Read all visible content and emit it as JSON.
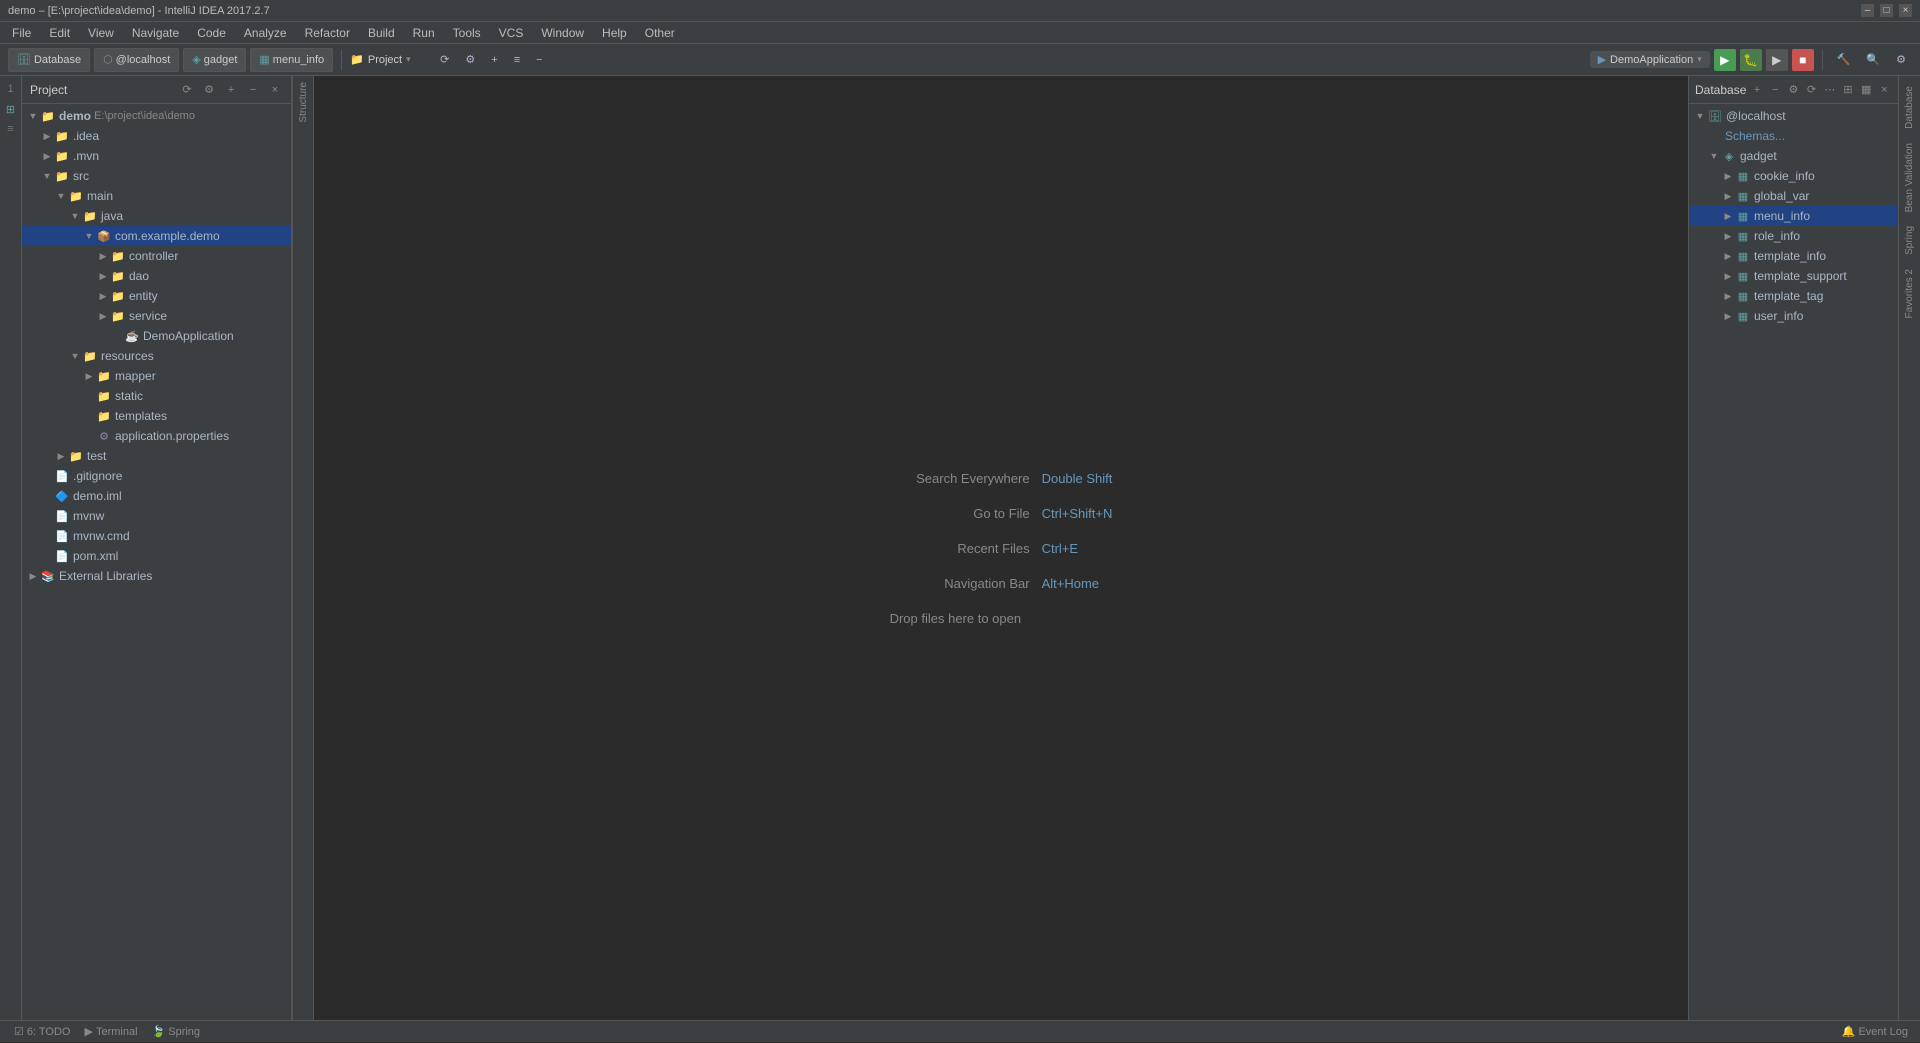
{
  "titleBar": {
    "title": "demo – [E:\\project\\idea\\demo] - IntelliJ IDEA 2017.2.7",
    "controls": [
      "–",
      "□",
      "×"
    ]
  },
  "menuBar": {
    "items": [
      "File",
      "Edit",
      "View",
      "Navigate",
      "Code",
      "Analyze",
      "Refactor",
      "Build",
      "Run",
      "Tools",
      "VCS",
      "Window",
      "Help",
      "Other"
    ]
  },
  "toolbar": {
    "dbTab": "Database",
    "localhostTab": "@localhost",
    "gadgetTab": "gadget",
    "menuInfoTab": "menu_info",
    "projectLabel": "Project",
    "runConfig": "DemoApplication",
    "icons": {
      "sync": "⟳",
      "settings": "⚙",
      "plus": "+",
      "minus": "−",
      "arrow": "▸"
    }
  },
  "projectTree": {
    "header": "Project",
    "items": [
      {
        "label": "demo",
        "sublabel": "E:\\project\\idea\\demo",
        "indent": 0,
        "type": "project",
        "expanded": true
      },
      {
        "label": ".idea",
        "indent": 1,
        "type": "folder",
        "expanded": false
      },
      {
        "label": ".mvn",
        "indent": 1,
        "type": "folder",
        "expanded": false
      },
      {
        "label": "src",
        "indent": 1,
        "type": "folder-src",
        "expanded": true
      },
      {
        "label": "main",
        "indent": 2,
        "type": "folder-main",
        "expanded": true
      },
      {
        "label": "java",
        "indent": 3,
        "type": "folder-java",
        "expanded": true
      },
      {
        "label": "com.example.demo",
        "indent": 4,
        "type": "package",
        "selected": true
      },
      {
        "label": "controller",
        "indent": 5,
        "type": "folder",
        "expanded": false
      },
      {
        "label": "dao",
        "indent": 5,
        "type": "folder",
        "expanded": false
      },
      {
        "label": "entity",
        "indent": 5,
        "type": "folder",
        "expanded": false
      },
      {
        "label": "service",
        "indent": 5,
        "type": "folder",
        "expanded": false
      },
      {
        "label": "DemoApplication",
        "indent": 5,
        "type": "class"
      },
      {
        "label": "resources",
        "indent": 3,
        "type": "folder-res",
        "expanded": true
      },
      {
        "label": "mapper",
        "indent": 4,
        "type": "folder",
        "expanded": false
      },
      {
        "label": "static",
        "indent": 4,
        "type": "folder",
        "expanded": false
      },
      {
        "label": "templates",
        "indent": 4,
        "type": "folder",
        "expanded": false
      },
      {
        "label": "application.properties",
        "indent": 4,
        "type": "prop"
      },
      {
        "label": "test",
        "indent": 2,
        "type": "folder",
        "expanded": false
      },
      {
        "label": ".gitignore",
        "indent": 1,
        "type": "file"
      },
      {
        "label": "demo.iml",
        "indent": 1,
        "type": "file-iml"
      },
      {
        "label": "mvnw",
        "indent": 1,
        "type": "file"
      },
      {
        "label": "mvnw.cmd",
        "indent": 1,
        "type": "file"
      },
      {
        "label": "pom.xml",
        "indent": 1,
        "type": "file-xml"
      },
      {
        "label": "External Libraries",
        "indent": 0,
        "type": "ext-lib",
        "expanded": false
      }
    ]
  },
  "editor": {
    "searchEverywhereLabel": "Search Everywhere",
    "searchEverywhereShortcut": "Double Shift",
    "goToFileLabel": "Go to File",
    "goToFileShortcut": "Ctrl+Shift+N",
    "recentFilesLabel": "Recent Files",
    "recentFilesShortcut": "Ctrl+E",
    "navigationBarLabel": "Navigation Bar",
    "navigationBarShortcut": "Alt+Home",
    "dropFilesLabel": "Drop files here to open"
  },
  "databasePanel": {
    "header": "Database",
    "items": [
      {
        "label": "@localhost",
        "indent": 0,
        "type": "db-conn",
        "expanded": true
      },
      {
        "label": "Schemas...",
        "indent": 1,
        "type": "placeholder"
      },
      {
        "label": "gadget",
        "indent": 1,
        "type": "schema",
        "expanded": true
      },
      {
        "label": "cookie_info",
        "indent": 2,
        "type": "table"
      },
      {
        "label": "global_var",
        "indent": 2,
        "type": "table"
      },
      {
        "label": "menu_info",
        "indent": 2,
        "type": "table",
        "selected": true
      },
      {
        "label": "role_info",
        "indent": 2,
        "type": "table"
      },
      {
        "label": "template_info",
        "indent": 2,
        "type": "table"
      },
      {
        "label": "template_support",
        "indent": 2,
        "type": "table"
      },
      {
        "label": "template_tag",
        "indent": 2,
        "type": "table"
      },
      {
        "label": "user_info",
        "indent": 2,
        "type": "table"
      }
    ]
  },
  "rightSideLabels": [
    "Bean Validation",
    "Spring",
    "Favorites 2",
    "Structure",
    "Event Log"
  ],
  "statusBar": {
    "todo": "6: TODO",
    "terminal": "Terminal",
    "spring": "Spring",
    "eventLog": "Event Log"
  }
}
